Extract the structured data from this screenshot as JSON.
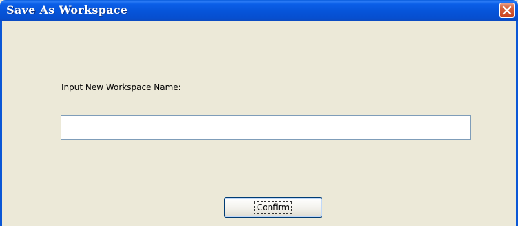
{
  "dialog": {
    "title": "Save As Workspace",
    "close_icon": "close-icon",
    "prompt_label": "Input New Workspace Name:",
    "name_input": {
      "value": "",
      "placeholder": ""
    },
    "confirm_label": "Confirm"
  },
  "colors": {
    "titlebar": "#0654d9",
    "window_body": "#ece9d8",
    "close_button": "#c9431d",
    "input_border": "#7f9db9",
    "button_border": "#003c74"
  }
}
